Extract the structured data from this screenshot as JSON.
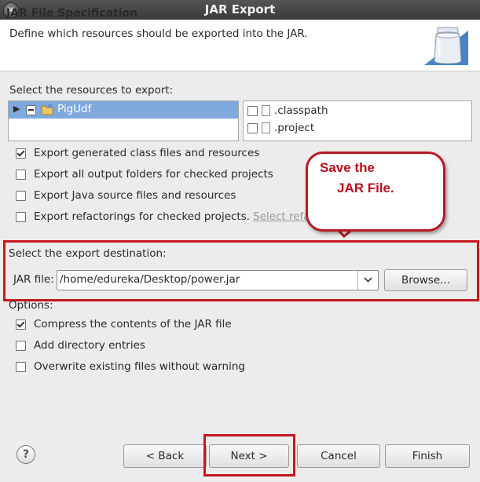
{
  "window": {
    "title": "JAR Export"
  },
  "header": {
    "title": "JAR File Specification",
    "description": "Define which resources should be exported into the JAR."
  },
  "resources": {
    "label": "Select the resources to export:",
    "tree": {
      "project": "PigUdf"
    },
    "files": [
      ".classpath",
      ".project"
    ]
  },
  "export_options": [
    {
      "label": "Export generated class files and resources",
      "checked": true
    },
    {
      "label": "Export all output folders for checked projects",
      "checked": false
    },
    {
      "label": "Export Java source files and resources",
      "checked": false
    },
    {
      "label": "Export refactorings for checked projects.",
      "checked": false,
      "link": "Select refac"
    }
  ],
  "callout": {
    "line1": "Save the",
    "line2": "JAR File."
  },
  "destination": {
    "label": "Select the export destination:",
    "field_label": "JAR file:",
    "value": "/home/edureka/Desktop/power.jar",
    "browse": "Browse..."
  },
  "options": {
    "label": "Options:",
    "items": [
      {
        "label": "Compress the contents of the JAR file",
        "checked": true
      },
      {
        "label": "Add directory entries",
        "checked": false
      },
      {
        "label": "Overwrite existing files without warning",
        "checked": false
      }
    ]
  },
  "footer": {
    "help": "?",
    "back": "< Back",
    "next": "Next >",
    "cancel": "Cancel",
    "finish": "Finish"
  },
  "colors": {
    "annotation_red": "#c4171f",
    "selection": "#7fa8dd"
  }
}
